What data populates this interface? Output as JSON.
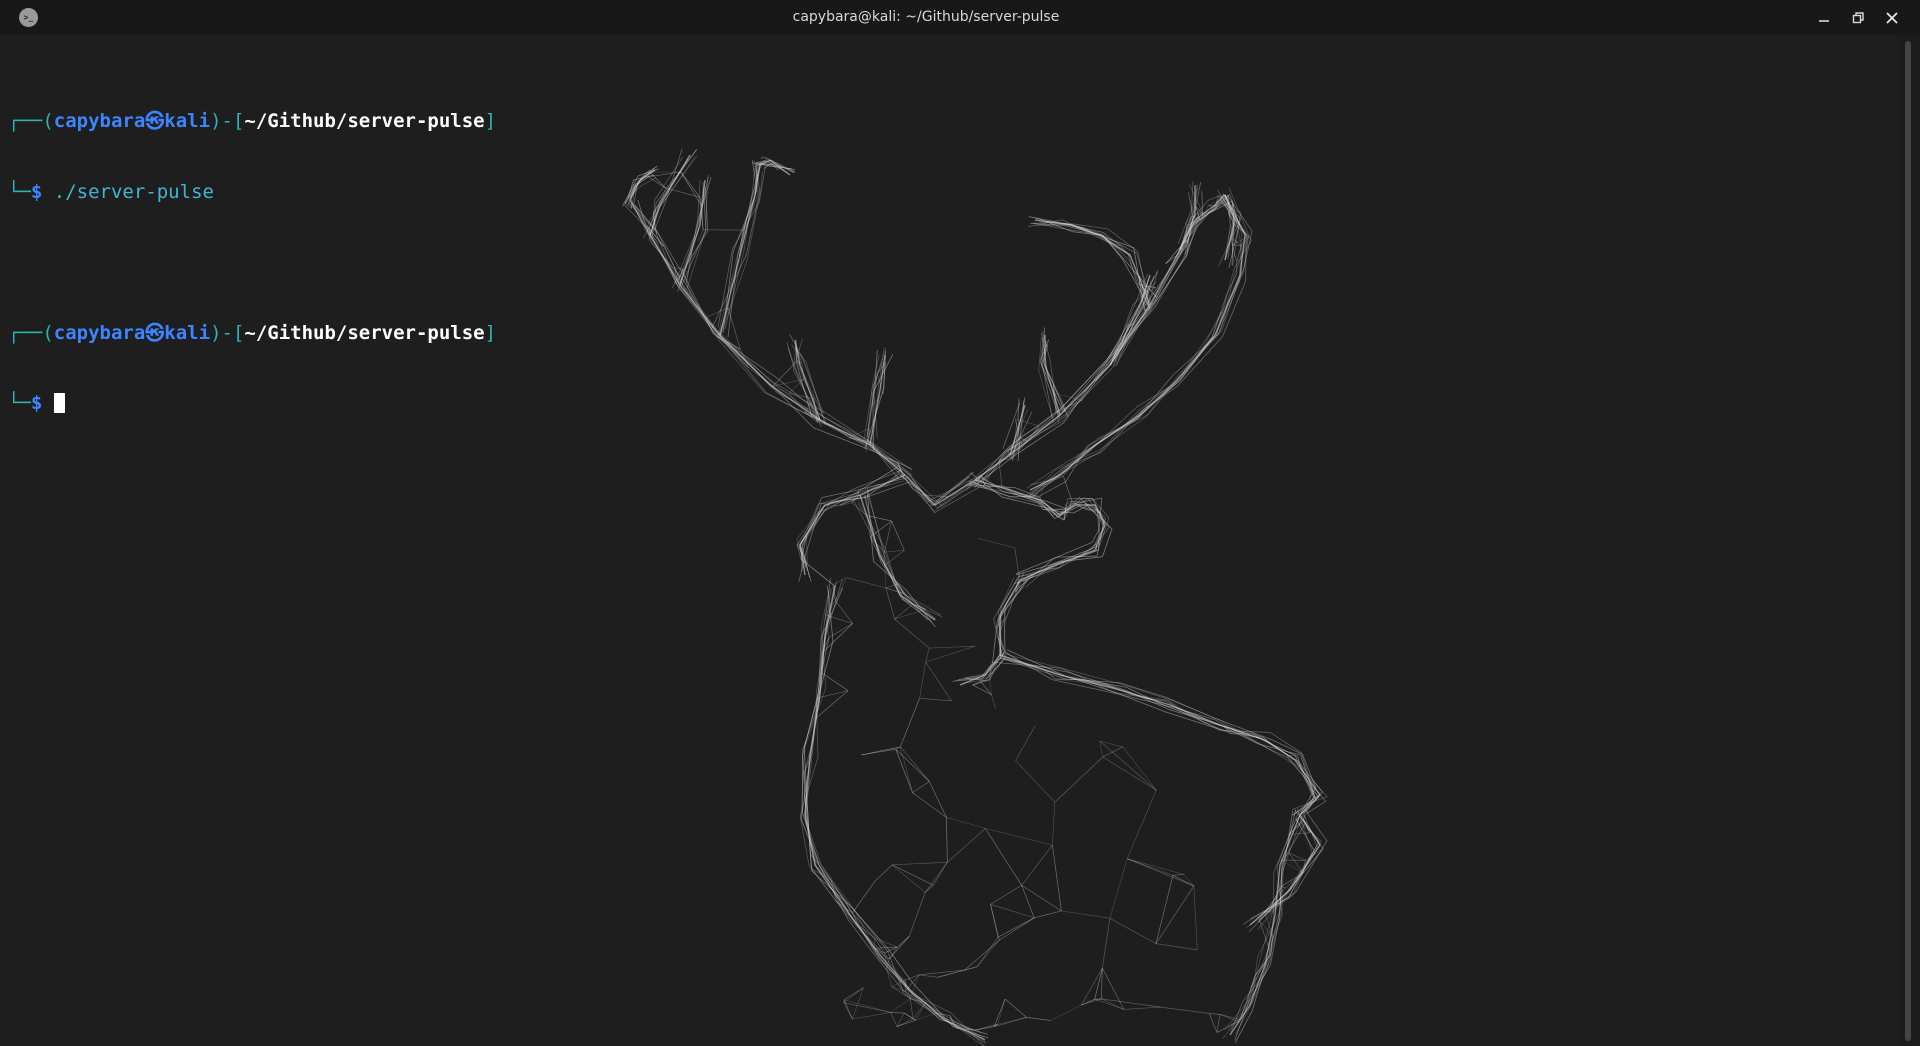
{
  "window": {
    "title": "capybara@kali: ~/Github/server-pulse",
    "app_icon": "terminal-icon",
    "controls": [
      "minimize-icon",
      "maximize-icon",
      "close-icon"
    ]
  },
  "terminal": {
    "blocks": [
      {
        "frame_open": "┌──(",
        "user": "capybara",
        "sep": "㉿",
        "host": "kali",
        "frame_mid": ")-[",
        "path": "~/Github/server-pulse",
        "frame_close": "]",
        "corner": "└─",
        "prompt": "$",
        "command": "./server-pulse"
      },
      {
        "frame_open": "┌──(",
        "user": "capybara",
        "sep": "㉿",
        "host": "kali",
        "frame_mid": ")-[",
        "path": "~/Github/server-pulse",
        "frame_close": "]",
        "corner": "└─",
        "prompt": "$",
        "command": ""
      }
    ]
  },
  "background": {
    "image": "polygonal-deer-head-wallpaper",
    "colors": {
      "bg": "#1e1e1e",
      "lines": "#d8d8d8"
    }
  },
  "colors": {
    "frame": "#2db3b3",
    "user": "#3d84ff",
    "path": "#ffffff",
    "command": "#3fb6cf"
  }
}
